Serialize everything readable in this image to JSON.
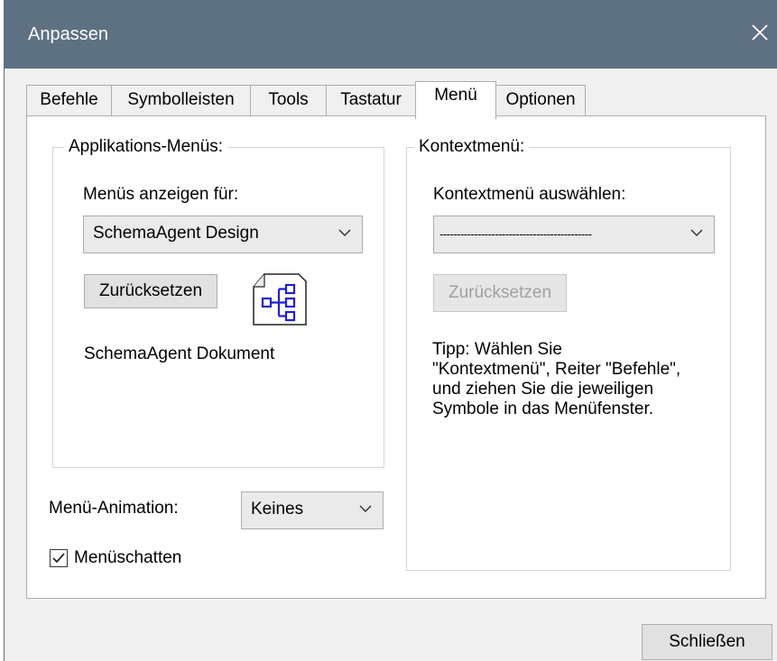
{
  "window": {
    "title": "Anpassen"
  },
  "tabs": [
    {
      "label": "Befehle"
    },
    {
      "label": "Symbolleisten"
    },
    {
      "label": "Tools"
    },
    {
      "label": "Tastatur"
    },
    {
      "label": "Menü"
    },
    {
      "label": "Optionen"
    }
  ],
  "active_tab": "Menü",
  "app_menus": {
    "legend": "Applikations-Menüs:",
    "show_for_label": "Menüs anzeigen für:",
    "show_for_value": "SchemaAgent Design",
    "reset_label": "Zurücksetzen",
    "doc_icon": "schema-document-icon",
    "doc_label": "SchemaAgent Dokument"
  },
  "context_menu": {
    "legend": "Kontextmenü:",
    "select_label": "Kontextmenü auswählen:",
    "select_value": "--------------------------------------------",
    "reset_label": "Zurücksetzen",
    "tip_lines": [
      "Tipp: Wählen Sie",
      "\"Kontextmenü\", Reiter \"Befehle\",",
      "und ziehen Sie die jeweiligen",
      "Symbole in das Menüfenster."
    ]
  },
  "animation": {
    "label": "Menü-Animation:",
    "value": "Keines"
  },
  "shadow": {
    "label": "Menüschatten",
    "checked": true
  },
  "footer": {
    "close_label": "Schließen"
  },
  "colors": {
    "titlebar": "#5e7183",
    "icon_accent": "#1f1fd6"
  }
}
